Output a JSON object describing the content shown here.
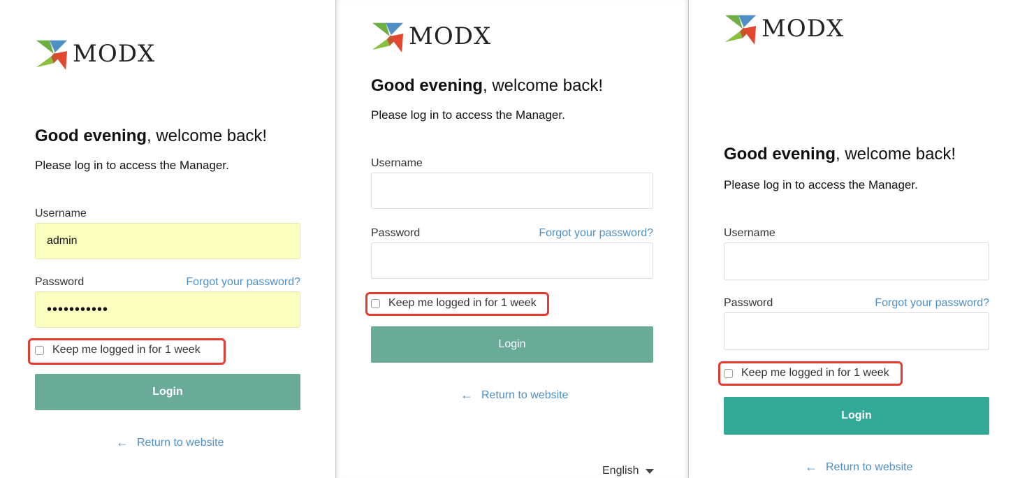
{
  "brand": {
    "name": "MODX",
    "colors": {
      "green": "#7cb342",
      "blue": "#4e8fc6",
      "red": "#e2482f",
      "teal": "#2ea895"
    }
  },
  "panels": [
    {
      "greeting_bold": "Good evening",
      "greeting_rest": ", welcome back!",
      "subtitle": "Please log in to access the Manager.",
      "username_label": "Username",
      "username_value": "admin",
      "password_label": "Password",
      "password_value": "•••••••••••",
      "forgot": "Forgot your password?",
      "remember": "Keep me logged in for 1 week",
      "login": "Login",
      "login_color": "#6aaa98",
      "return": "Return to website"
    },
    {
      "greeting_bold": "Good evening",
      "greeting_rest": ", welcome back!",
      "subtitle": "Please log in to access the Manager.",
      "username_label": "Username",
      "username_value": "",
      "password_label": "Password",
      "password_value": "",
      "forgot": "Forgot your password?",
      "remember": "Keep me logged in for 1 week",
      "login": "Login",
      "login_color": "#6aaa98",
      "return": "Return to website",
      "language": "English"
    },
    {
      "greeting_bold": "Good evening",
      "greeting_rest": ", welcome back!",
      "subtitle": "Please log in to access the Manager.",
      "username_label": "Username",
      "username_value": "",
      "password_label": "Password",
      "password_value": "",
      "forgot": "Forgot your password?",
      "remember": "Keep me logged in for 1 week",
      "login": "Login",
      "login_color": "#31a996",
      "return": "Return to website"
    }
  ],
  "icons": {
    "logo": "modx-logo-icon",
    "arrow": "arrow-left-icon",
    "caret": "caret-down-icon"
  }
}
